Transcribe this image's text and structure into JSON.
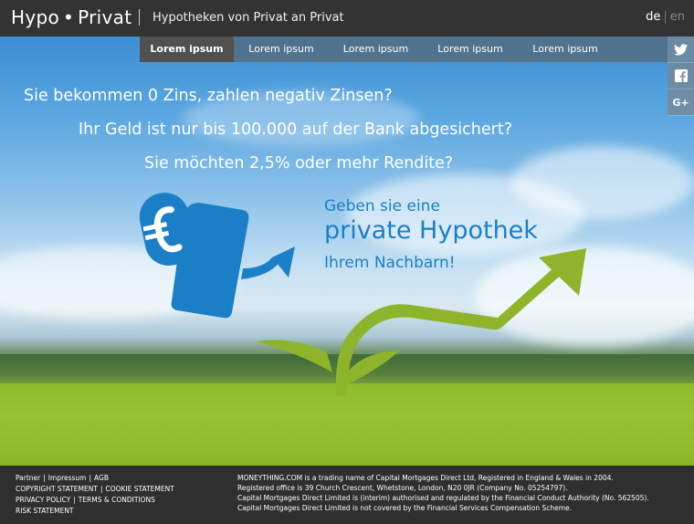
{
  "header": {
    "logo_left": "Hypo",
    "logo_dot": "•",
    "logo_right": "Privat",
    "tagline": "Hypotheken von Privat an Privat",
    "lang_de": "de",
    "lang_sep": "|",
    "lang_en": "en"
  },
  "nav": {
    "items": [
      {
        "label": "Lorem ipsum",
        "active": true
      },
      {
        "label": "Lorem ipsum"
      },
      {
        "label": "Lorem ipsum"
      },
      {
        "label": "Lorem ipsum"
      },
      {
        "label": "Lorem ipsum"
      }
    ]
  },
  "social": {
    "icons": [
      "twitter-icon",
      "facebook-icon",
      "google-plus-icon"
    ],
    "gplus": "G+"
  },
  "hero": {
    "q1": "Sie bekommen 0 Zins, zahlen negativ Zinsen?",
    "q2": "Ihr Geld ist nur bis 100.000 auf der Bank abgesichert?",
    "q3": "Sie möchten 2,5% oder mehr Rendite?",
    "cta1": "Geben sie eine",
    "cta2": "private Hypothek",
    "cta3": "Ihrem Nachbarn!",
    "colors": {
      "cta_blue": "#1b7fc7",
      "plant_green": "#8db42b"
    }
  },
  "footer": {
    "partner": "Partner",
    "impressum": "Impressum",
    "agb": "AGB",
    "copyright": "COPYRIGHT STATEMENT",
    "cookie": "COOKIE STATEMENT",
    "privacy": "PRIVACY POLICY",
    "terms": "TERMS & CONDITIONS",
    "risk": "RISK STATEMENT",
    "pipe": "|",
    "legal1": "MONEYTHING.COM is a trading name of Capital Mortgages Direct Ltd, Registered in England & Wales in 2004.",
    "legal2": "Registered office is 39 Church Crescent, Whetstone, London, N20 0JR (Company No. 05254797).",
    "legal3": "Capital Mortgages Direct Limited is (interim) authorised and regulated by the Financial Conduct Authority (No. 562505).",
    "legal4": "Capital Mortgages Direct Limited is not covered by the Financial Services Compensation Scheme."
  }
}
